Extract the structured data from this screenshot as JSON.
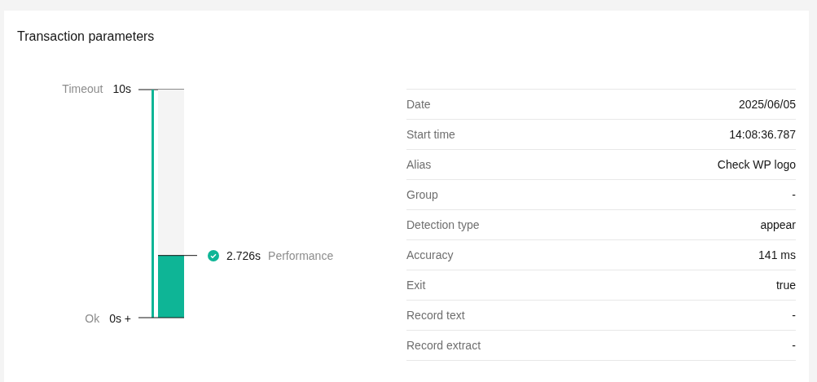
{
  "title": "Transaction parameters",
  "gauge": {
    "max_label": "Timeout",
    "max_value": "10s",
    "min_label": "Ok",
    "min_value": "0s +",
    "level": 0.2726,
    "reading": "2.726s",
    "reading_label": "Performance",
    "passed": true
  },
  "details": [
    {
      "label": "Date",
      "value": "2025/06/05"
    },
    {
      "label": "Start time",
      "value": "14:08:36.787"
    },
    {
      "label": "Alias",
      "value": "Check WP logo"
    },
    {
      "label": "Group",
      "value": "-"
    },
    {
      "label": "Detection type",
      "value": "appear"
    },
    {
      "label": "Accuracy",
      "value": "141 ms"
    },
    {
      "label": "Exit",
      "value": "true"
    },
    {
      "label": "Record text",
      "value": "-"
    },
    {
      "label": "Record extract",
      "value": "-"
    }
  ]
}
